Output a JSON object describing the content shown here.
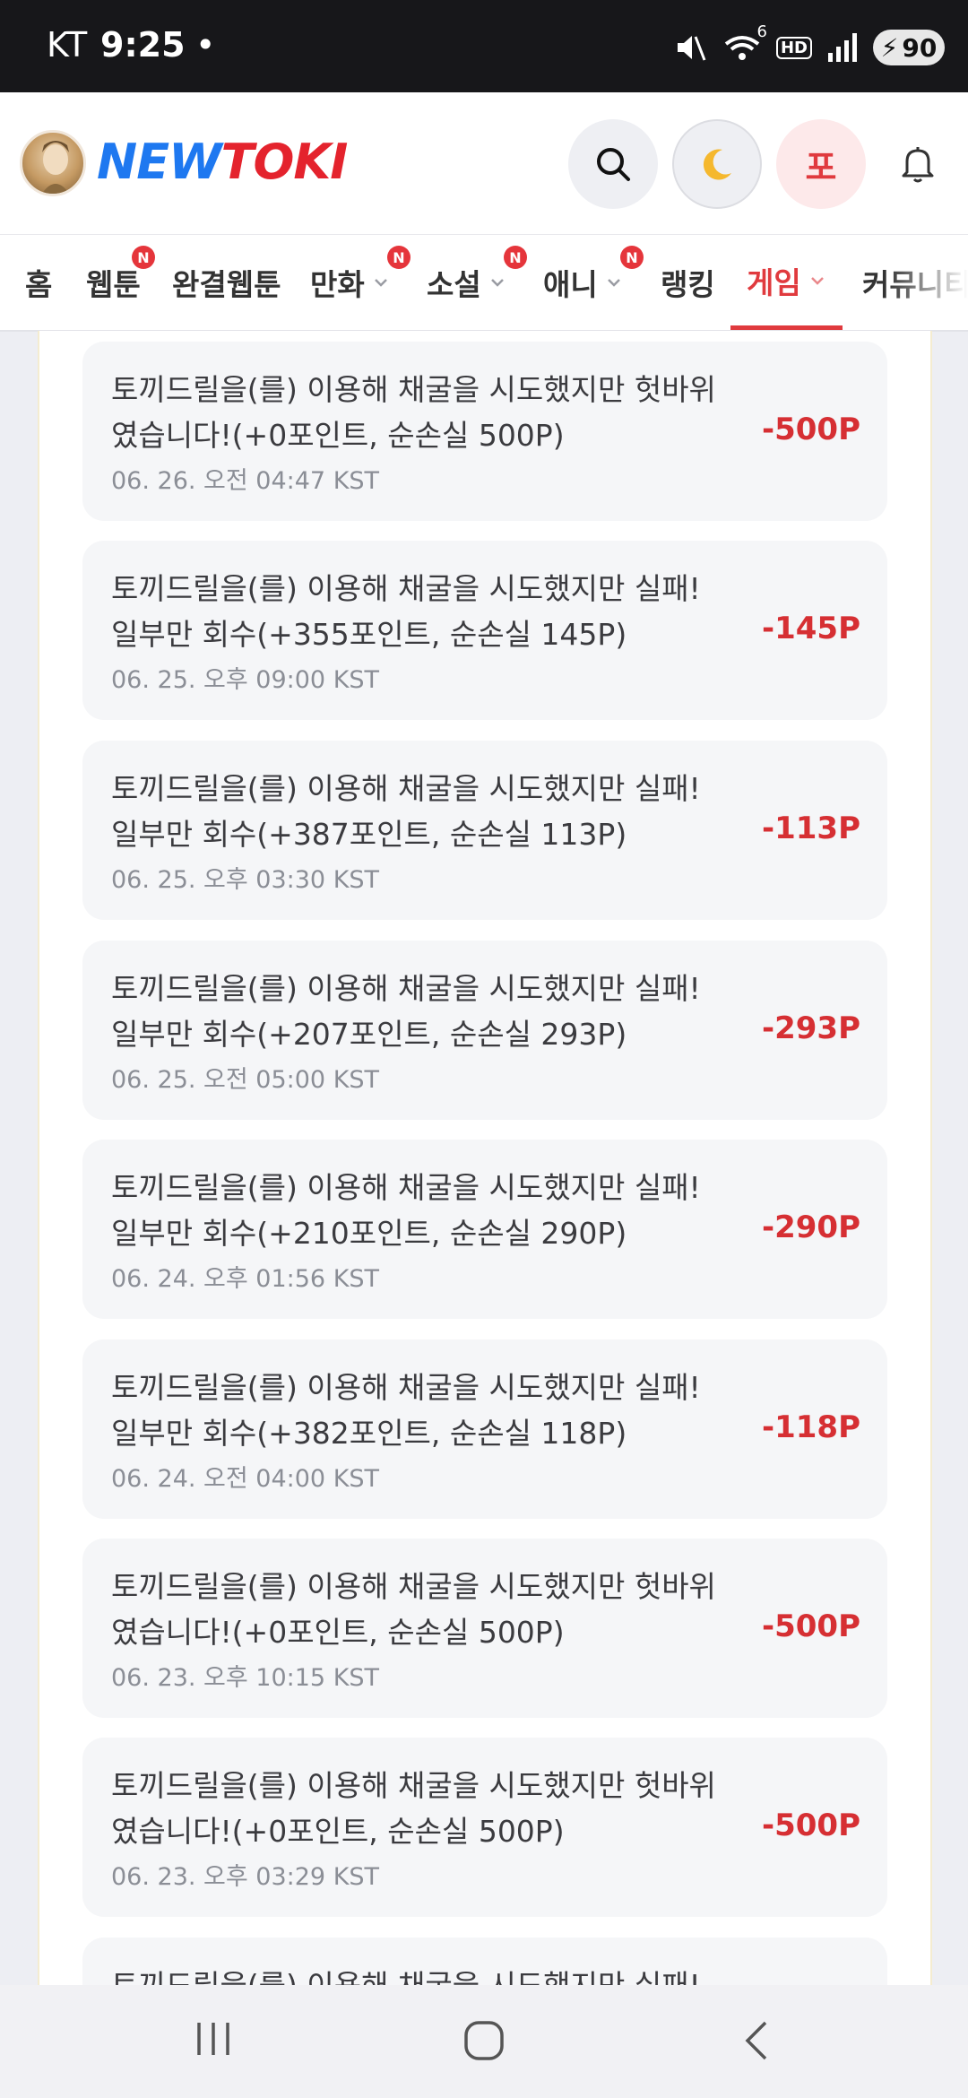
{
  "status_bar": {
    "carrier": "KT",
    "time": "9:25",
    "dot": "•",
    "wifi_label": "6",
    "hd_label": "HD",
    "battery": "90"
  },
  "header": {
    "logo_part1": "NEW",
    "logo_part2": "TOKI",
    "user_initial": "포"
  },
  "nav": {
    "items": [
      {
        "label": "홈"
      },
      {
        "label": "웹툰",
        "badge": "N"
      },
      {
        "label": "완결웹툰"
      },
      {
        "label": "만화",
        "badge": "N"
      },
      {
        "label": "소설",
        "badge": "N"
      },
      {
        "label": "애니",
        "badge": "N"
      },
      {
        "label": "랭킹"
      },
      {
        "label": "게임"
      },
      {
        "label": "커뮤니티"
      }
    ]
  },
  "history": [
    {
      "line1": "토끼드릴을(를) 이용해 채굴을 시도했지만 헛바위",
      "line2": "였습니다!(+0포인트, 순손실 500P)",
      "time": "06. 26. 오전 04:47 KST",
      "amount": "-500P"
    },
    {
      "line1": "토끼드릴을(를) 이용해 채굴을 시도했지만 실패!",
      "line2": "일부만 회수(+355포인트, 순손실 145P)",
      "time": "06. 25. 오후 09:00 KST",
      "amount": "-145P"
    },
    {
      "line1": "토끼드릴을(를) 이용해 채굴을 시도했지만 실패!",
      "line2": "일부만 회수(+387포인트, 순손실 113P)",
      "time": "06. 25. 오후 03:30 KST",
      "amount": "-113P"
    },
    {
      "line1": "토끼드릴을(를) 이용해 채굴을 시도했지만 실패!",
      "line2": "일부만 회수(+207포인트, 순손실 293P)",
      "time": "06. 25. 오전 05:00 KST",
      "amount": "-293P"
    },
    {
      "line1": "토끼드릴을(를) 이용해 채굴을 시도했지만 실패!",
      "line2": "일부만 회수(+210포인트, 순손실 290P)",
      "time": "06. 24. 오후 01:56 KST",
      "amount": "-290P"
    },
    {
      "line1": "토끼드릴을(를) 이용해 채굴을 시도했지만 실패!",
      "line2": "일부만 회수(+382포인트, 순손실 118P)",
      "time": "06. 24. 오전 04:00 KST",
      "amount": "-118P"
    },
    {
      "line1": "토끼드릴을(를) 이용해 채굴을 시도했지만 헛바위",
      "line2": "였습니다!(+0포인트, 순손실 500P)",
      "time": "06. 23. 오후 10:15 KST",
      "amount": "-500P"
    },
    {
      "line1": "토끼드릴을(를) 이용해 채굴을 시도했지만 헛바위",
      "line2": "였습니다!(+0포인트, 순손실 500P)",
      "time": "06. 23. 오후 03:29 KST",
      "amount": "-500P"
    },
    {
      "line1": "토끼드릴을(를) 이용해 채굴을 시도했지만 실패!",
      "line2": "",
      "time": "",
      "amount": ""
    }
  ]
}
